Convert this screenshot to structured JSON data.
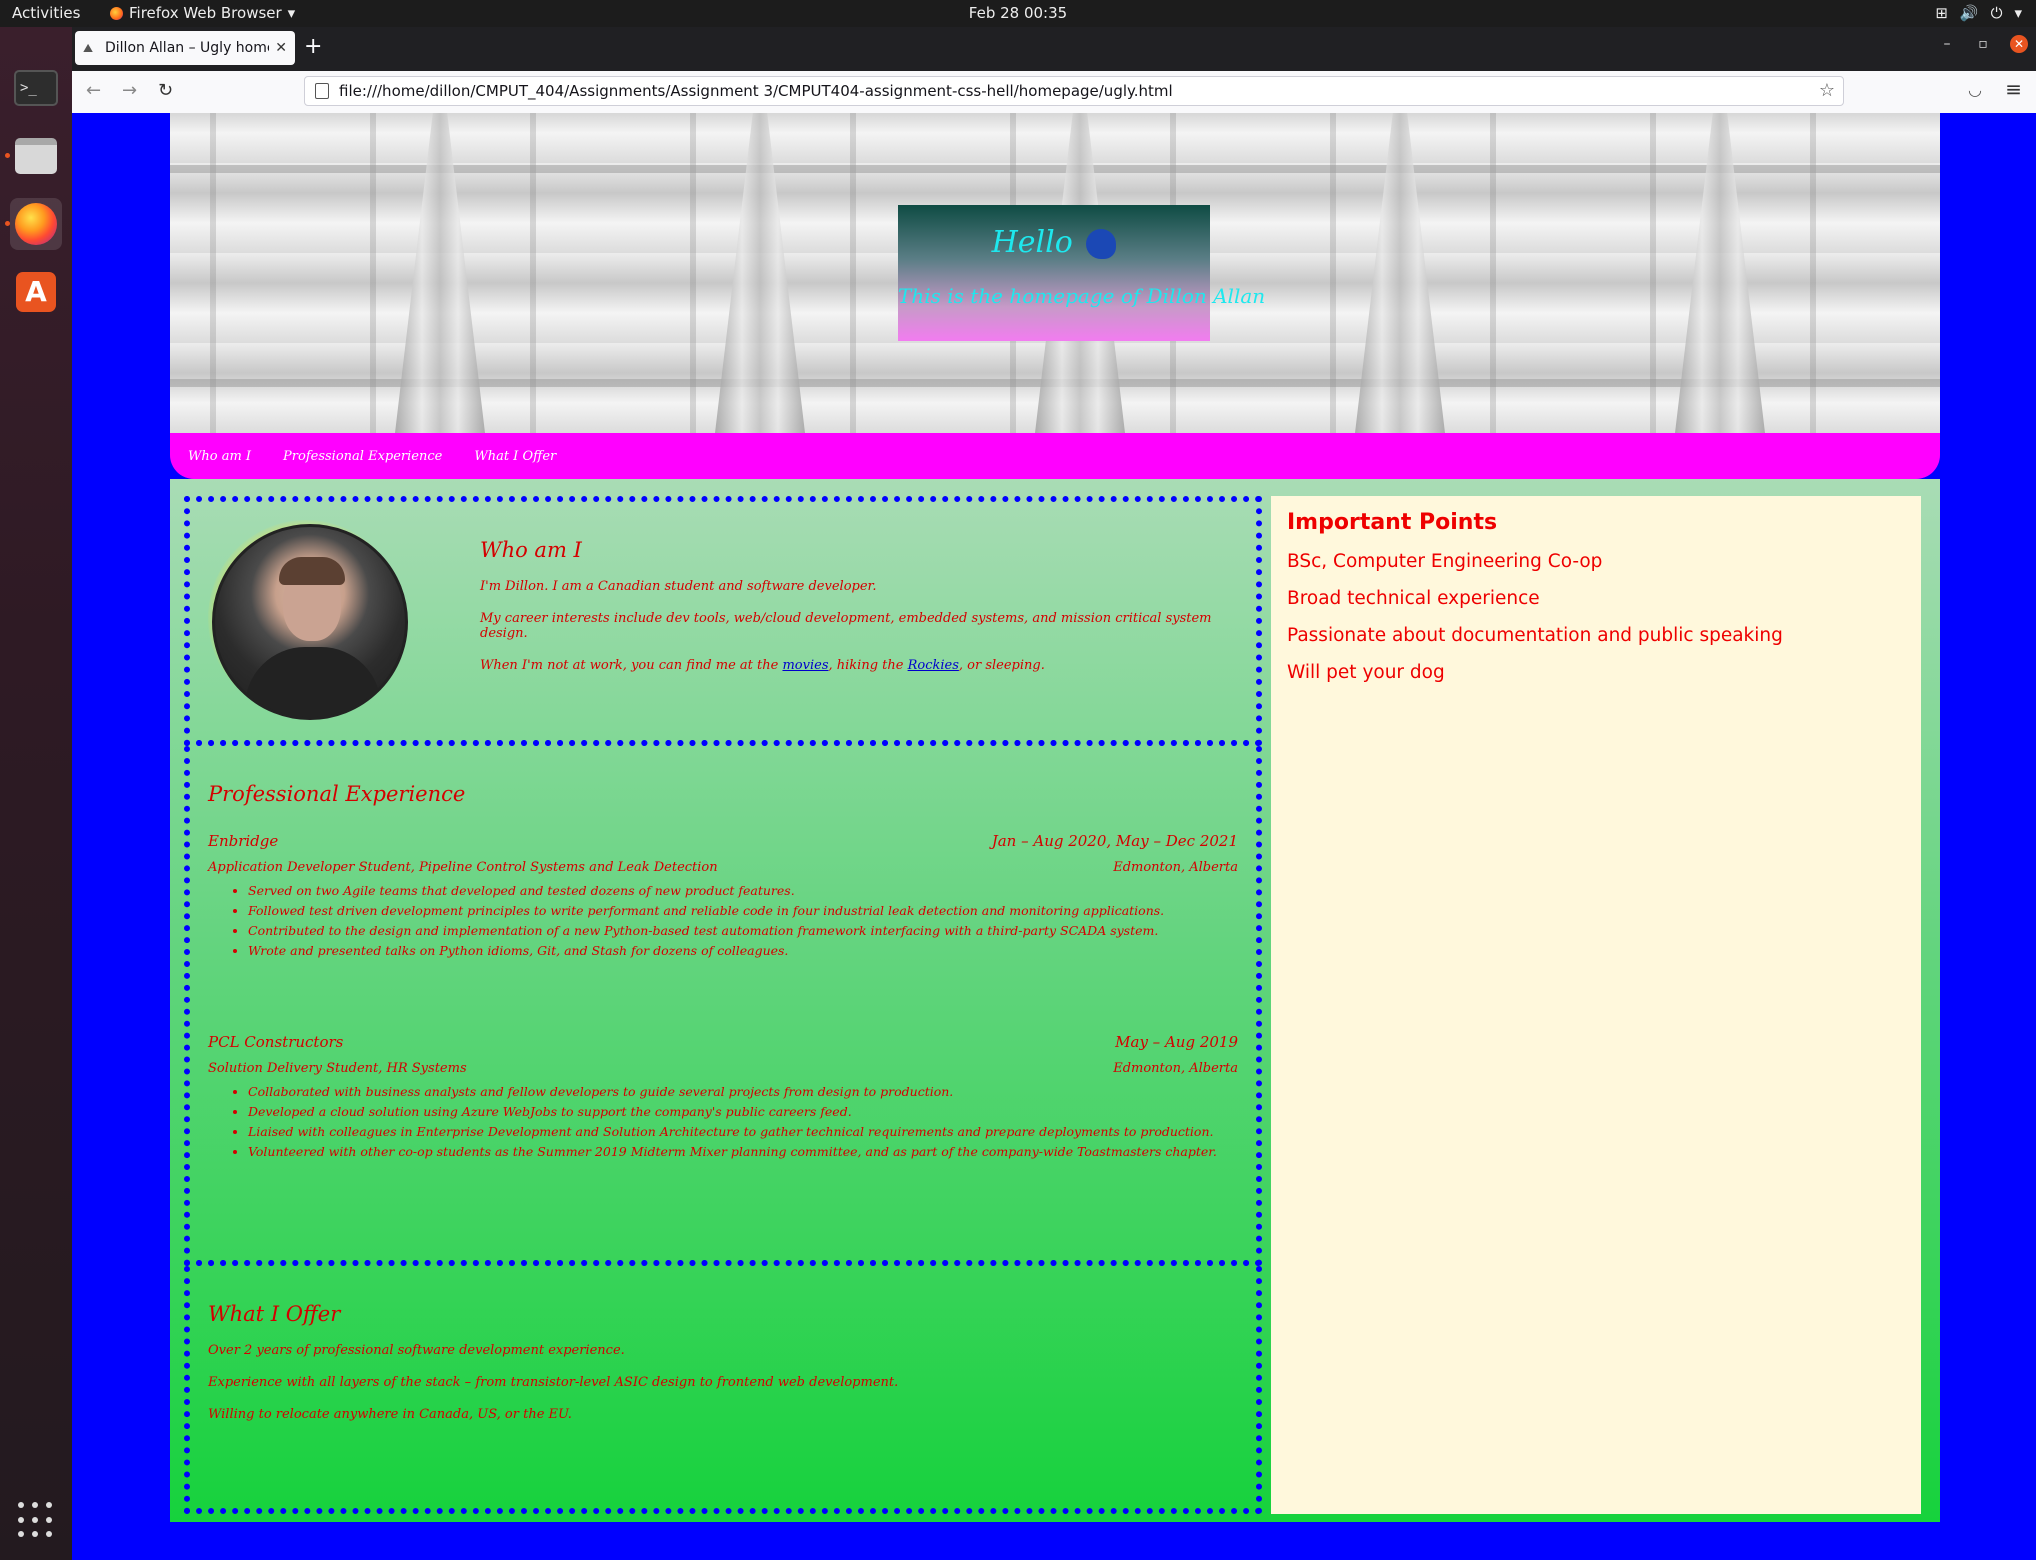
{
  "topbar": {
    "activities": "Activities",
    "app_name": "Firefox Web Browser",
    "clock": "Feb 28  00:35"
  },
  "dock": {
    "items": [
      "terminal-icon",
      "files-icon",
      "firefox-icon",
      "software-store-icon"
    ],
    "terminal_glyph": ">_",
    "store_glyph": "A"
  },
  "browser": {
    "tab_title": "Dillon Allan – Ugly homep",
    "url": "file:///home/dillon/CMPUT_404/Assignments/Assignment 3/CMPUT404-assignment-css-hell/homepage/ugly.html"
  },
  "page": {
    "hello": "Hello",
    "subtitle": "This is the homepage of Dillon Allan",
    "nav": [
      "Who am I",
      "Professional Experience",
      "What I Offer"
    ],
    "who": {
      "title": "Who am I",
      "p1": "I'm Dillon. I am a Canadian student and software developer.",
      "p2": "My career interests include dev tools, web/cloud development, embedded systems, and mission critical system design.",
      "p3_before": "When I'm not at work, you can find me at the ",
      "p3_link1": "movies",
      "p3_mid": ", hiking the ",
      "p3_link2": "Rockies",
      "p3_after": ", or sleeping."
    },
    "experience": {
      "title": "Professional Experience",
      "jobs": [
        {
          "company": "Enbridge",
          "dates": "Jan – Aug 2020, May – Dec 2021",
          "role": "Application Developer Student, Pipeline Control Systems and Leak Detection",
          "location": "Edmonton, Alberta",
          "bullets": [
            "Served on two Agile teams that developed and tested dozens of new product features.",
            "Followed test driven development principles to write performant and reliable code in four industrial leak detection and monitoring applications.",
            "Contributed to the design and implementation of a new Python-based test automation framework interfacing with a third-party SCADA system.",
            "Wrote and presented talks on Python idioms, Git, and Stash for dozens of colleagues."
          ]
        },
        {
          "company": "PCL Constructors",
          "dates": "May – Aug 2019",
          "role": "Solution Delivery Student, HR Systems",
          "location": "Edmonton, Alberta",
          "bullets": [
            "Collaborated with business analysts and fellow developers to guide several projects from design to production.",
            "Developed a cloud solution using Azure WebJobs to support the company's public careers feed.",
            "Liaised with colleagues in Enterprise Development and Solution Architecture to gather technical requirements and prepare deployments to production.",
            "Volunteered with other co-op students as the Summer 2019 Midterm Mixer planning committee, and as part of the company-wide Toastmasters chapter."
          ]
        }
      ]
    },
    "offer": {
      "title": "What I Offer",
      "items": [
        "Over 2 years of professional software development experience.",
        "Experience with all layers of the stack – from transistor-level ASIC design to frontend web development.",
        "Willing to relocate anywhere in Canada, US, or the EU."
      ]
    },
    "aside": {
      "title": "Important Points",
      "points": [
        "BSc, Computer Engineering Co-op",
        "Broad technical experience",
        "Passionate about documentation and public speaking",
        "Will pet your dog"
      ]
    }
  },
  "colors": {
    "page_bg": "#0000ff",
    "nav_bg": "#ff00ff",
    "text_red": "#d40000",
    "aside_bg": "#fff8dc",
    "hello_text": "#1ee8ee"
  }
}
